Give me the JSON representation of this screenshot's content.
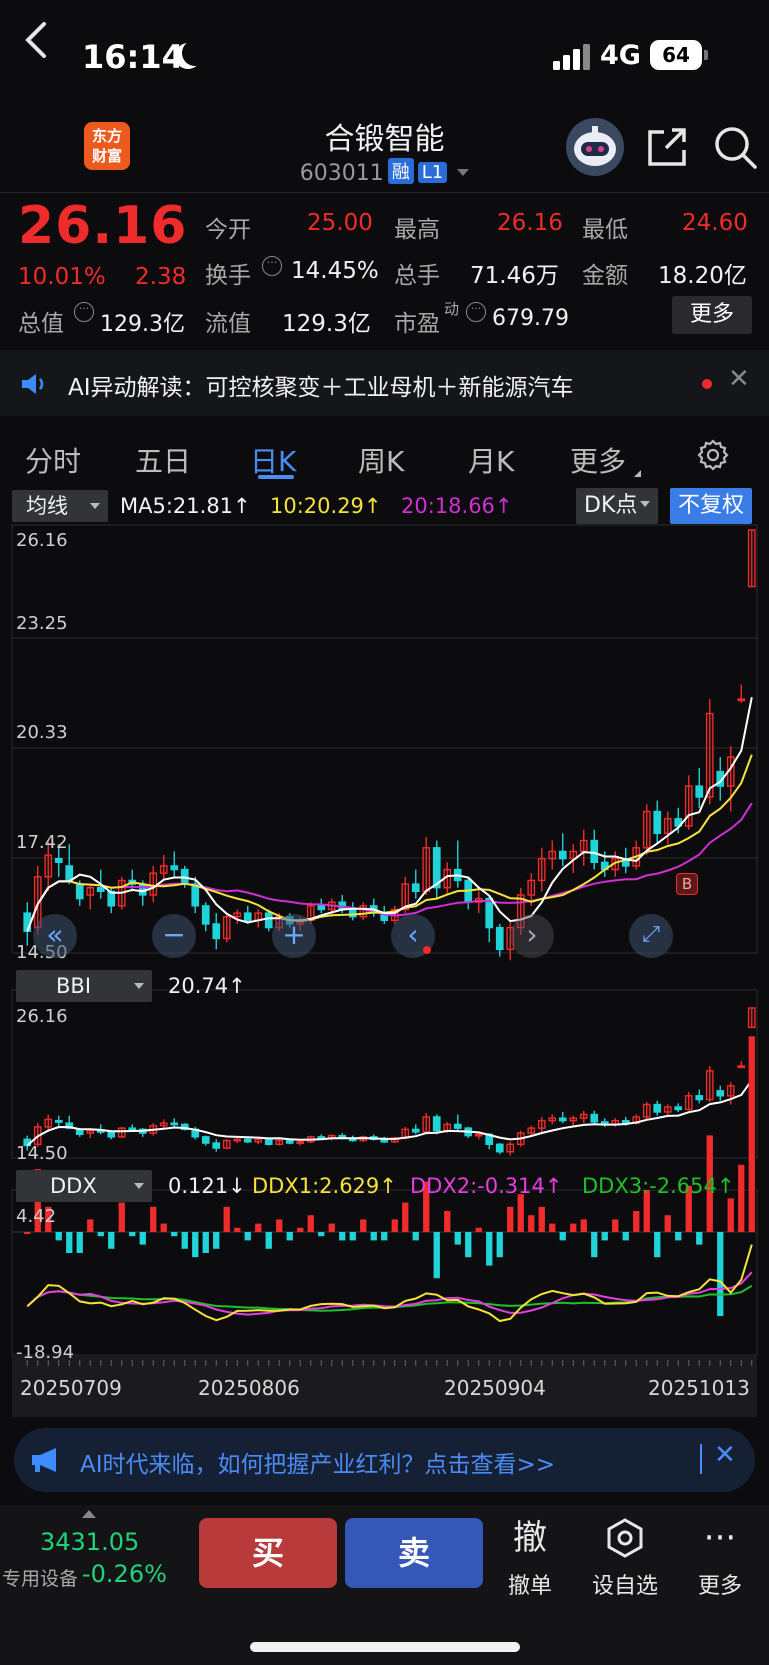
{
  "status": {
    "time": "16:14",
    "network": "4G",
    "battery": "64"
  },
  "header": {
    "logo_line1": "东方",
    "logo_line2": "财富",
    "title": "合锻智能",
    "code": "603011",
    "tag1": "融",
    "tag2": "L1"
  },
  "quote": {
    "price": "26.16",
    "pct": "10.01%",
    "chg": "2.38",
    "open_label": "今开",
    "open": "25.00",
    "high_label": "最高",
    "high": "26.16",
    "low_label": "最低",
    "low": "24.60",
    "turnover_label": "换手",
    "turnover": "14.45%",
    "volume_label": "总手",
    "volume": "71.46万",
    "amount_label": "金额",
    "amount": "18.20亿",
    "mcap_label": "总值",
    "mcap": "129.3亿",
    "float_label": "流值",
    "float": "129.3亿",
    "pe_label": "市盈",
    "pe_sup": "动",
    "pe": "679.79",
    "more": "更多"
  },
  "ai_banner": {
    "text": "AI异动解读：可控核聚变＋工业母机＋新能源汽车"
  },
  "tabs": [
    "分时",
    "五日",
    "日K",
    "周K",
    "月K",
    "更多"
  ],
  "active_tab": "日K",
  "main_chart": {
    "selector": "均线",
    "ma5": "MA5:21.81",
    "ma10": "10:20.29",
    "ma20": "20:18.66",
    "dk": "DK点",
    "fq": "不复权",
    "y_labels": [
      "26.16",
      "23.25",
      "20.33",
      "17.42",
      "14.50"
    ],
    "b_marker": "B"
  },
  "bbi": {
    "selector": "BBI",
    "value": "20.74",
    "y_top": "26.16",
    "y_bottom": "14.50"
  },
  "ddx": {
    "selector": "DDX",
    "value": "0.121",
    "ddx1": "DDX1:2.629",
    "ddx2": "DDX2:-0.314",
    "ddx3": "DDX3:-2.654",
    "y_top": "4.42",
    "y_bottom": "-18.94"
  },
  "dates": [
    "20250709",
    "20250806",
    "20250904",
    "20251013"
  ],
  "ai_promo": {
    "text": "AI时代来临，如何把握产业红利？点击查看>>"
  },
  "index": {
    "value": "3431.05",
    "label": "专用设备",
    "pct": "-0.26%"
  },
  "actions": {
    "buy": "买",
    "sell": "卖",
    "cancel_icon": "撤",
    "cancel": "撤单",
    "watch": "设自选",
    "more": "更多"
  },
  "colors": {
    "up": "#f02b2b",
    "down": "#1fd3d8",
    "ma5": "#ffffff",
    "ma10": "#f5e33c",
    "ma20": "#d12fd6",
    "ddx2": "#e53ee0",
    "ddx3": "#1fc02a",
    "accent": "#4b8bf5"
  },
  "chart_data": {
    "type": "candlestick",
    "ohlc": [
      [
        15.6,
        15.9,
        14.7,
        15.1
      ],
      [
        15.2,
        16.9,
        15.0,
        16.6
      ],
      [
        16.6,
        17.6,
        16.2,
        17.2
      ],
      [
        17.1,
        17.5,
        16.6,
        17.0
      ],
      [
        16.9,
        17.5,
        16.4,
        16.5
      ],
      [
        16.4,
        16.5,
        15.8,
        16.0
      ],
      [
        16.1,
        16.4,
        15.7,
        16.3
      ],
      [
        16.3,
        16.8,
        16.0,
        16.2
      ],
      [
        16.2,
        16.3,
        15.6,
        15.8
      ],
      [
        15.8,
        16.6,
        15.7,
        16.5
      ],
      [
        16.5,
        16.8,
        16.2,
        16.4
      ],
      [
        16.4,
        16.5,
        15.8,
        16.1
      ],
      [
        16.1,
        16.9,
        15.9,
        16.7
      ],
      [
        16.7,
        17.2,
        16.5,
        16.9
      ],
      [
        16.9,
        17.3,
        16.6,
        16.8
      ],
      [
        16.8,
        16.9,
        16.3,
        16.4
      ],
      [
        16.4,
        16.6,
        15.6,
        15.8
      ],
      [
        15.8,
        15.9,
        15.1,
        15.3
      ],
      [
        15.3,
        15.6,
        14.6,
        14.9
      ],
      [
        14.9,
        15.6,
        14.8,
        15.5
      ],
      [
        15.5,
        15.7,
        15.3,
        15.6
      ],
      [
        15.6,
        15.8,
        15.3,
        15.4
      ],
      [
        15.4,
        15.7,
        15.2,
        15.6
      ],
      [
        15.6,
        15.7,
        15.1,
        15.2
      ],
      [
        15.2,
        15.6,
        15.1,
        15.5
      ],
      [
        15.5,
        15.6,
        15.2,
        15.3
      ],
      [
        15.3,
        15.5,
        15.1,
        15.4
      ],
      [
        15.4,
        15.9,
        15.3,
        15.8
      ],
      [
        15.8,
        16.0,
        15.6,
        15.7
      ],
      [
        15.7,
        16.0,
        15.5,
        15.9
      ],
      [
        15.9,
        16.1,
        15.6,
        15.7
      ],
      [
        15.7,
        15.9,
        15.4,
        15.5
      ],
      [
        15.5,
        15.9,
        15.4,
        15.8
      ],
      [
        15.8,
        16.0,
        15.5,
        15.6
      ],
      [
        15.6,
        15.8,
        15.3,
        15.4
      ],
      [
        15.4,
        15.8,
        15.3,
        15.7
      ],
      [
        15.7,
        16.6,
        15.6,
        16.4
      ],
      [
        16.4,
        16.8,
        16.0,
        16.2
      ],
      [
        16.2,
        17.7,
        16.1,
        17.4
      ],
      [
        17.4,
        17.6,
        16.0,
        16.3
      ],
      [
        16.3,
        17.0,
        16.1,
        16.8
      ],
      [
        16.8,
        17.6,
        16.3,
        16.5
      ],
      [
        16.5,
        16.6,
        15.7,
        15.9
      ],
      [
        15.9,
        16.2,
        15.6,
        16.0
      ],
      [
        16.0,
        16.1,
        14.8,
        15.2
      ],
      [
        15.2,
        15.3,
        14.4,
        14.6
      ],
      [
        14.6,
        15.4,
        14.3,
        15.2
      ],
      [
        15.2,
        16.3,
        15.0,
        16.1
      ],
      [
        16.1,
        16.7,
        15.8,
        16.5
      ],
      [
        16.5,
        17.4,
        16.2,
        17.1
      ],
      [
        17.1,
        17.6,
        16.8,
        17.3
      ],
      [
        17.3,
        17.8,
        16.9,
        17.1
      ],
      [
        17.1,
        17.5,
        16.7,
        17.3
      ],
      [
        17.3,
        17.9,
        16.9,
        17.6
      ],
      [
        17.6,
        17.9,
        16.8,
        17.0
      ],
      [
        17.0,
        17.3,
        16.6,
        16.8
      ],
      [
        16.8,
        17.3,
        16.6,
        17.1
      ],
      [
        17.1,
        17.4,
        16.7,
        16.9
      ],
      [
        16.9,
        17.6,
        16.8,
        17.4
      ],
      [
        17.4,
        18.6,
        17.2,
        18.4
      ],
      [
        18.4,
        18.7,
        17.5,
        17.8
      ],
      [
        17.8,
        18.4,
        17.5,
        18.2
      ],
      [
        18.2,
        18.5,
        17.8,
        18.0
      ],
      [
        18.0,
        19.4,
        17.9,
        19.1
      ],
      [
        19.1,
        19.6,
        18.5,
        18.8
      ],
      [
        18.8,
        21.5,
        18.6,
        21.1
      ],
      [
        19.5,
        19.9,
        18.7,
        19.1
      ],
      [
        19.1,
        20.2,
        18.4,
        19.9
      ],
      [
        21.5,
        21.9,
        21.4,
        21.5
      ],
      [
        24.6,
        26.16,
        24.6,
        26.16
      ]
    ],
    "ma5_last": 21.81,
    "ma10_last": 20.29,
    "ma20_last": 18.66,
    "bbi_last": 20.74,
    "ylim": [
      14.5,
      26.16
    ]
  }
}
